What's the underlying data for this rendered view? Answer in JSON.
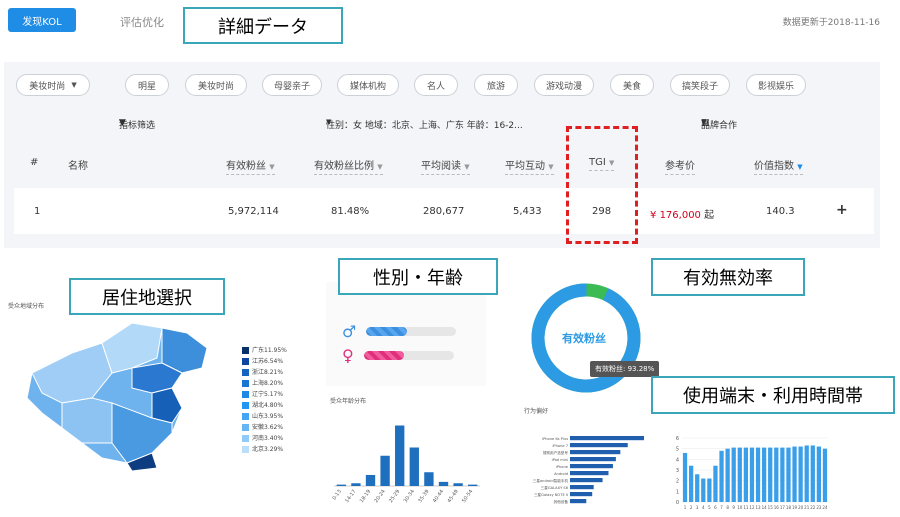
{
  "header": {
    "discover_button": "发现KOL",
    "eval_tab": "评估优化",
    "updated": "数据更新于2018-11-16"
  },
  "callouts": {
    "details": "詳細データ",
    "residence": "居住地選択",
    "gender_age": "性別・年齢",
    "valid_rate": "有効無効率",
    "device_time": "使用端末・利用時間帯"
  },
  "chips": [
    "美妆时尚",
    "明星",
    "美妆时尚",
    "母婴亲子",
    "媒体机构",
    "名人",
    "旅游",
    "游戏动漫",
    "美食",
    "搞笑段子",
    "影视娱乐"
  ],
  "filters": {
    "metric": "指标筛选",
    "criteria": "性别：女 地域：北京、上海、广东 年龄：16-2...",
    "brand": "品牌合作"
  },
  "table": {
    "headers": [
      "#",
      "名称",
      "有效粉丝",
      "有效粉丝比例",
      "平均阅读",
      "平均互动",
      "TGI",
      "参考价",
      "价值指数"
    ],
    "row": {
      "rank": "1",
      "followers": "5,972,114",
      "ratio": "81.48%",
      "reads": "280,677",
      "interactions": "5,433",
      "tgi": "298",
      "price_currency": "¥",
      "price_value": "176,000",
      "price_suffix": "起",
      "value_index": "140.3",
      "add": "+"
    }
  },
  "map": {
    "title": "受众地域分布",
    "legend": [
      "广东11.95%",
      "江苏6.54%",
      "浙江8.21%",
      "上海8.20%",
      "辽宁5.17%",
      "湖北4.80%",
      "山东3.95%",
      "安徽3.62%",
      "河南3.40%",
      "北京3.29%"
    ],
    "legend_colors": [
      "#08306b",
      "#0d47a1",
      "#1565c0",
      "#1976d2",
      "#1e88e5",
      "#2196f3",
      "#42a5f5",
      "#64b5f6",
      "#90caf9",
      "#bbdefb"
    ]
  },
  "gender": {
    "male_symbol": "♂",
    "female_symbol": "♀",
    "male_level": 0.45,
    "female_level": 0.45
  },
  "age_chart": {
    "title": "受众年龄分布",
    "chart_data": {
      "type": "bar",
      "categories": [
        "0-13",
        "14-17",
        "18-19",
        "20-24",
        "25-29",
        "30-34",
        "35-39",
        "40-44",
        "45-49",
        "50-54"
      ],
      "values": [
        1,
        2,
        8,
        22,
        44,
        28,
        10,
        3,
        2,
        1
      ],
      "ylim": [
        0,
        48
      ],
      "color": "#1f6fbf"
    }
  },
  "donut": {
    "label": "有效粉丝",
    "tooltip": "有效粉丝: 93.28%",
    "valid_pct": 93.28,
    "colors": {
      "valid": "#2d9be3",
      "invalid": "#3cba54"
    }
  },
  "device_chart": {
    "title": "行为偏好",
    "chart_data": {
      "type": "bar",
      "categories": [
        "iPhone 6s Plus",
        "iPhone 7",
        "搜狗用户选型号",
        "iPad mini",
        "iPhone",
        "Android",
        "三星android智能手机",
        "三星GALAXY S6",
        "三星Galaxy NOTE II",
        "其他设备"
      ],
      "values": [
        100,
        78,
        68,
        62,
        58,
        52,
        44,
        32,
        30,
        22
      ],
      "color": "#1f5fad"
    }
  },
  "time_chart": {
    "chart_data": {
      "type": "bar",
      "categories": [
        "1",
        "2",
        "3",
        "4",
        "5",
        "6",
        "7",
        "8",
        "9",
        "10",
        "11",
        "12",
        "13",
        "14",
        "15",
        "16",
        "17",
        "18",
        "19",
        "20",
        "21",
        "22",
        "23",
        "24"
      ],
      "values": [
        4.6,
        3.4,
        2.6,
        2.2,
        2.2,
        3.4,
        4.8,
        5.0,
        5.1,
        5.1,
        5.1,
        5.1,
        5.1,
        5.1,
        5.1,
        5.1,
        5.1,
        5.1,
        5.2,
        5.2,
        5.3,
        5.3,
        5.2,
        5.0
      ],
      "ylim": [
        0,
        6
      ],
      "yticks": [
        "0",
        "1",
        "2",
        "3",
        "4",
        "5",
        "6"
      ],
      "color": "#3a9ee8"
    }
  }
}
